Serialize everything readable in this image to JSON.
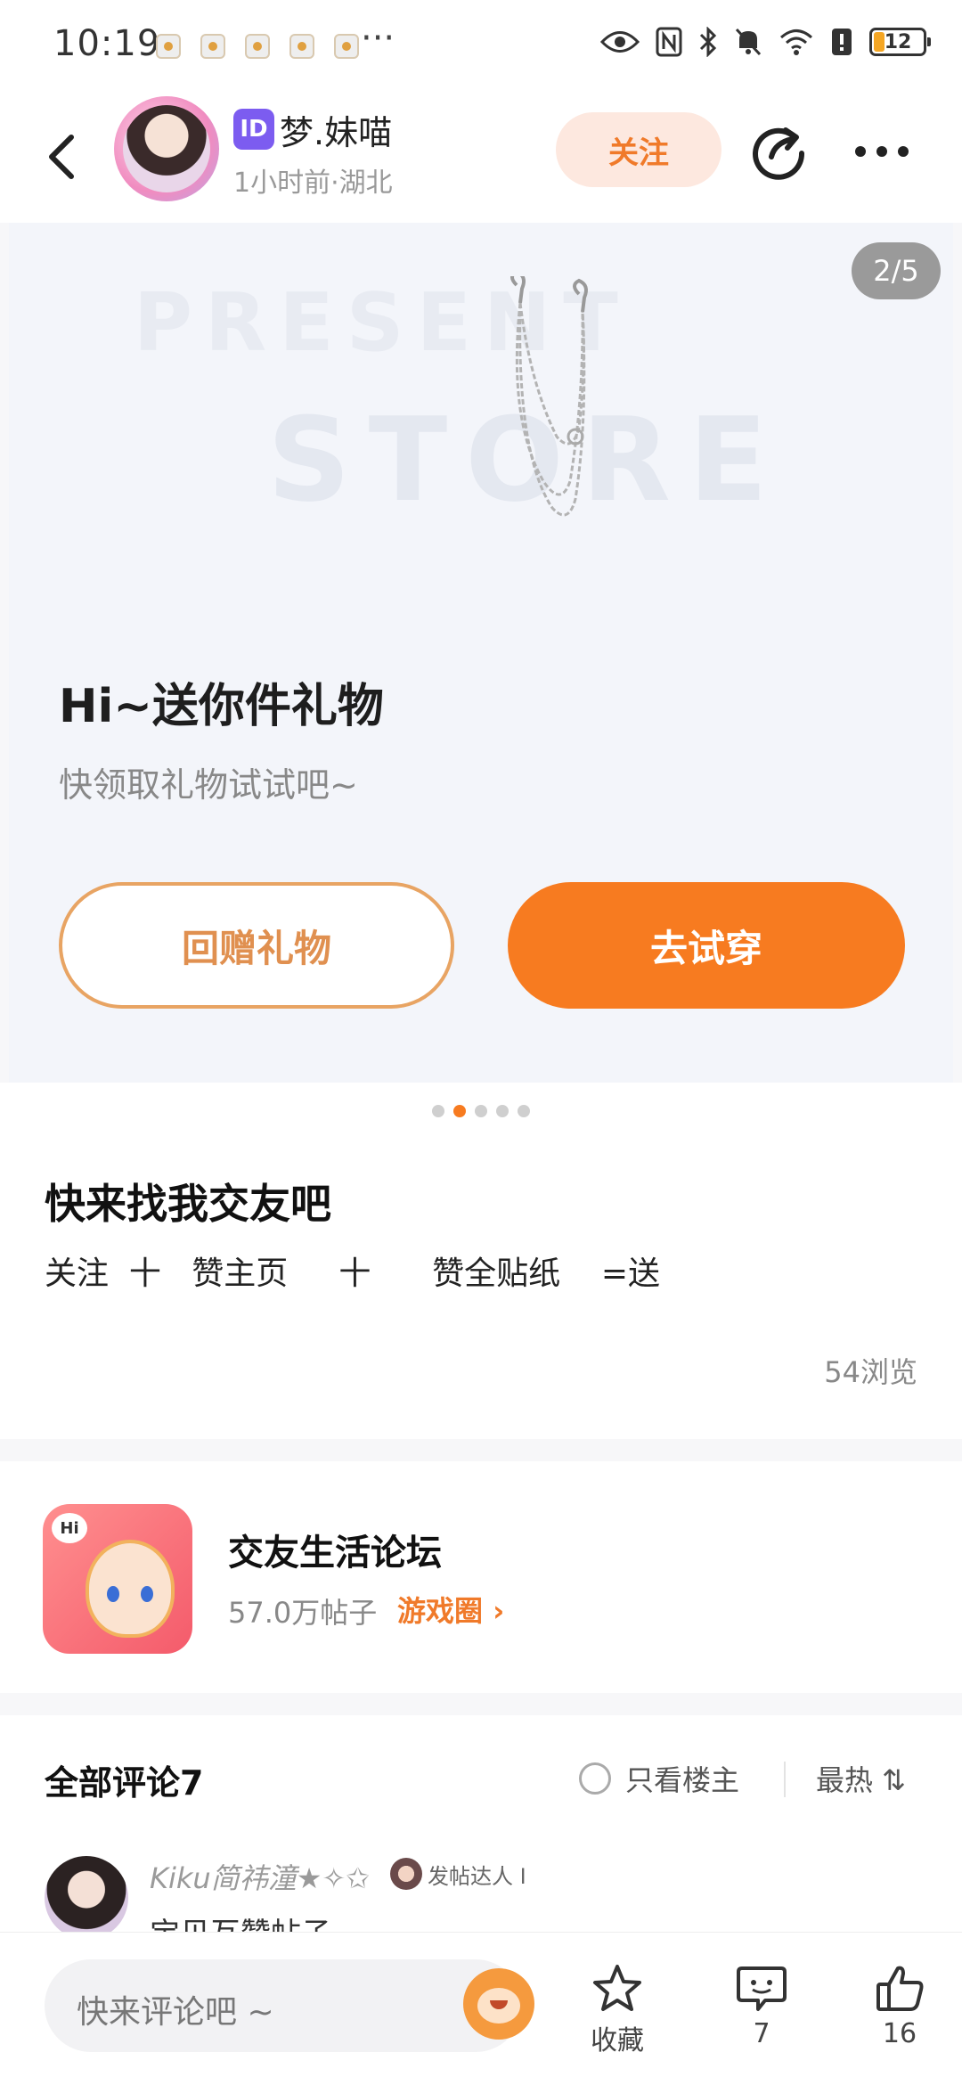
{
  "status_bar": {
    "time": "10:19",
    "more": "···",
    "battery": "12"
  },
  "header": {
    "id_badge": "ID",
    "username": "梦.妹喵",
    "subinfo": "1小时前·湖北",
    "follow_label": "关注"
  },
  "carousel": {
    "page_counter": "2/5",
    "watermark_line1": "PRESENT",
    "watermark_line2": "STORE",
    "gift_title": "Hi~送你件礼物",
    "gift_subtitle": "快领取礼物试试吧~",
    "return_gift_label": "回赠礼物",
    "try_on_label": "去试穿",
    "total_pages": 5,
    "current_page": 2
  },
  "post": {
    "title": "快来找我交友吧",
    "body": "关注  十   赞主页     十      赞全贴纸    =送",
    "views": "54浏览"
  },
  "forum": {
    "icon_hi": "Hi",
    "name": "交友生活论坛",
    "post_count": "57.0万帖子",
    "tag": "游戏圈 ›"
  },
  "comments": {
    "title": "全部评论7",
    "only_op_label": "只看楼主",
    "sort_label": "最热 ⇅",
    "first": {
      "name": "Kiku简祎潼★✧✩",
      "badge": "发帖达人 I",
      "text": "宝贝互赞帖子"
    }
  },
  "bottom_bar": {
    "input_placeholder": "快来评论吧 ~",
    "collect_label": "收藏",
    "comment_count": "7",
    "like_count": "16"
  },
  "colors": {
    "accent": "#f77b20",
    "follow_bg": "#fde8df",
    "id_badge": "#7c5cf0"
  }
}
